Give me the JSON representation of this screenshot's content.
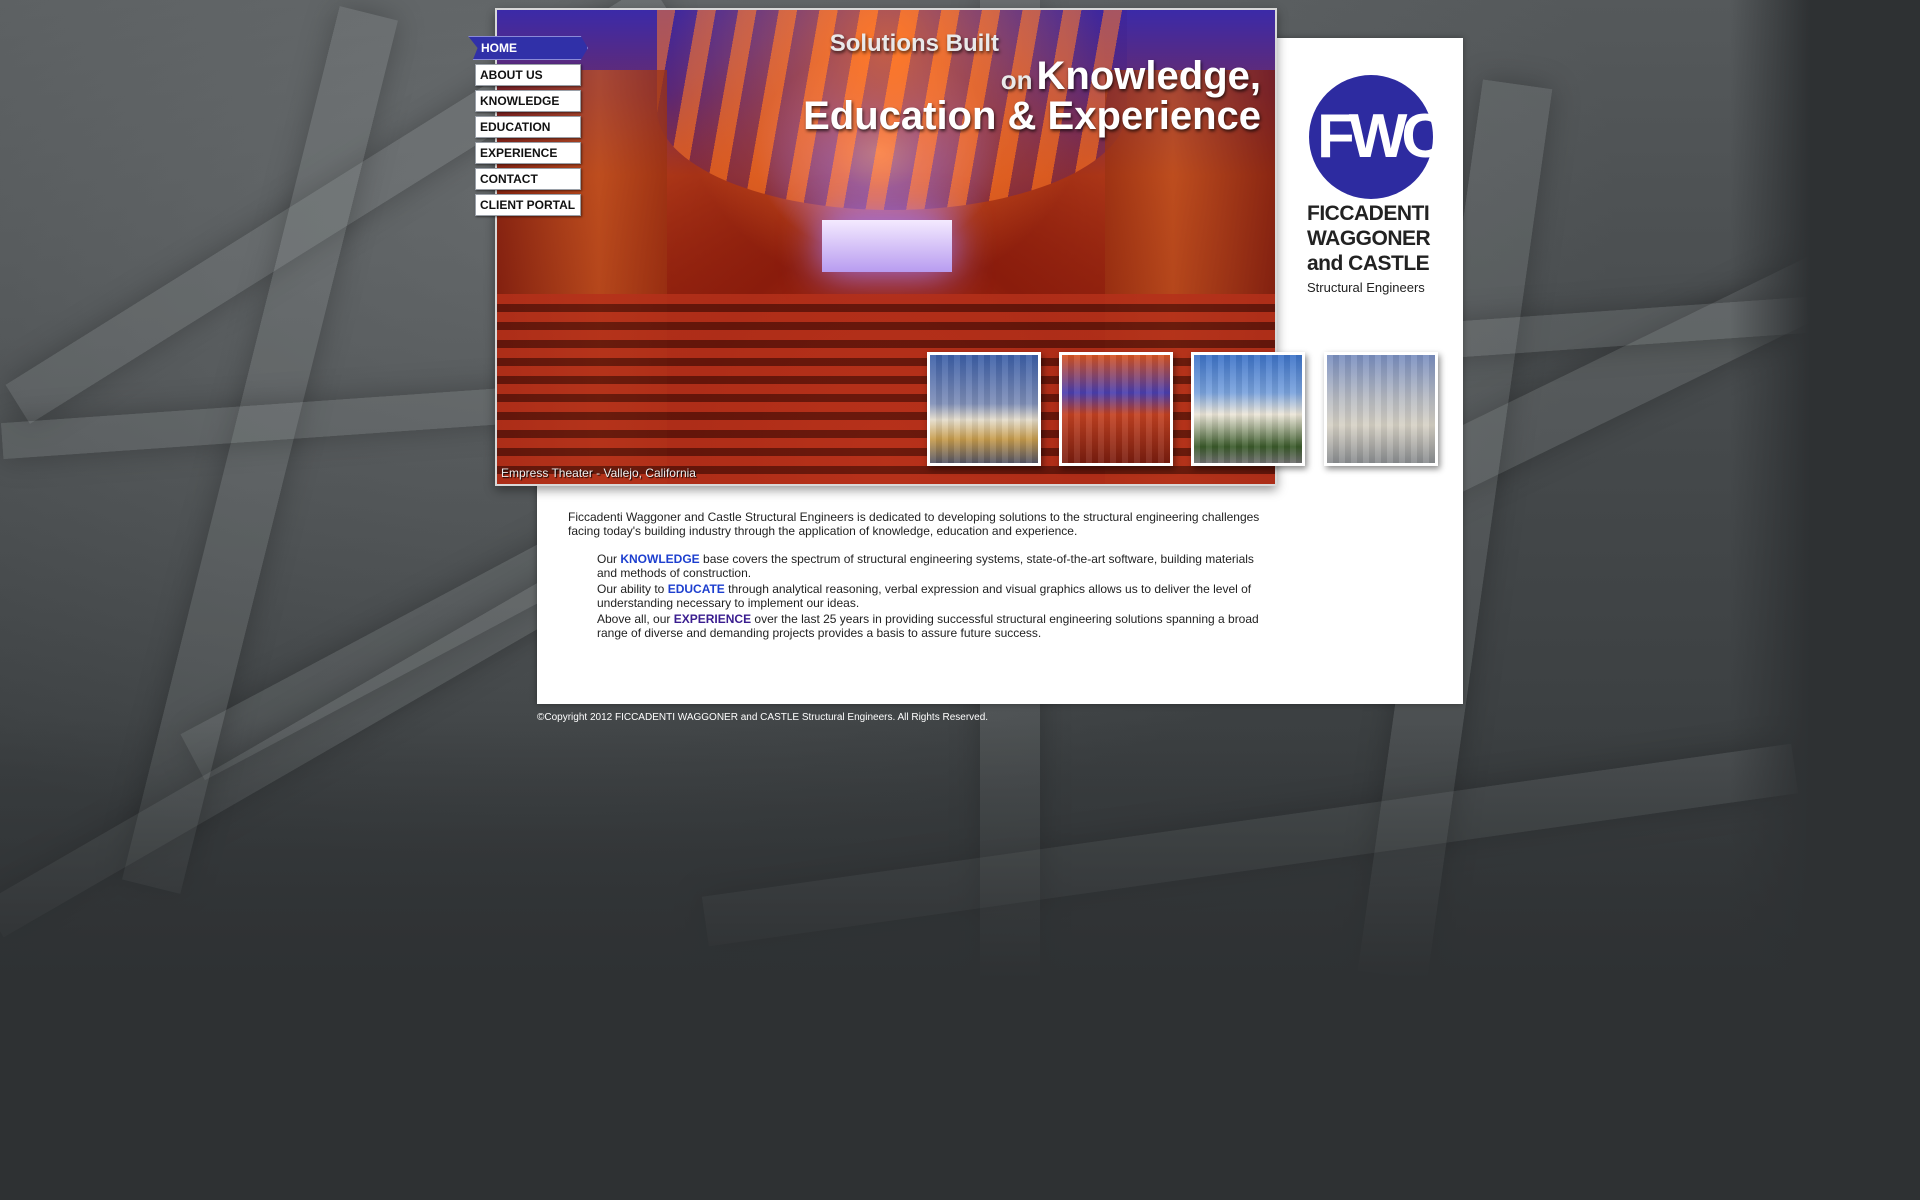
{
  "nav": {
    "items": [
      {
        "label": "HOME",
        "active": true
      },
      {
        "label": "ABOUT US"
      },
      {
        "label": "KNOWLEDGE"
      },
      {
        "label": "EDUCATION"
      },
      {
        "label": "EXPERIENCE"
      },
      {
        "label": "CONTACT"
      },
      {
        "label": "CLIENT PORTAL"
      }
    ]
  },
  "hero": {
    "tagline_line1": "Solutions Built",
    "tagline_on": "on",
    "tagline_line2": "Knowledge,",
    "tagline_line3": "Education & Experience",
    "caption": "Empress Theater - Vallejo, California"
  },
  "logo": {
    "monogram": "FWC",
    "name_line1": "FICCADENTI",
    "name_line2": "WAGGONER",
    "name_line3": "and CASTLE",
    "subtitle": "Structural Engineers",
    "brand_color": "#2d2ba0"
  },
  "thumbnails": [
    {
      "icon": "building-photo"
    },
    {
      "icon": "theater-photo"
    },
    {
      "icon": "hotel-photo"
    },
    {
      "icon": "glass-building-photo"
    }
  ],
  "content": {
    "intro": "Ficcadenti Waggoner and Castle Structural Engineers is dedicated to developing solutions to the structural engineering challenges facing today's building industry through the application of knowledge, education and experience.",
    "p1_pre": "Our ",
    "p1_kw": "KNOWLEDGE",
    "p1_post": " base covers the spectrum of structural engineering systems, state-of-the-art software, building materials and methods of construction.",
    "p2_pre": "Our ability to ",
    "p2_kw": "EDUCATE",
    "p2_post": " through analytical reasoning, verbal expression and visual graphics allows us to deliver the level of understanding necessary to implement our ideas.",
    "p3_pre": "Above all, our ",
    "p3_kw": "EXPERIENCE",
    "p3_post": " over the last 25 years in providing successful structural engineering solutions spanning a broad range of diverse and demanding projects provides a basis to assure future success."
  },
  "footer": {
    "copyright": "©Copyright 2012 FICCADENTI WAGGONER and CASTLE Structural Engineers. All Rights Reserved."
  },
  "colors": {
    "nav_active": "#3030a8",
    "keyword_blue": "#1d3fcf",
    "keyword_purple": "#3a1d8f",
    "background": "#2e3133"
  }
}
